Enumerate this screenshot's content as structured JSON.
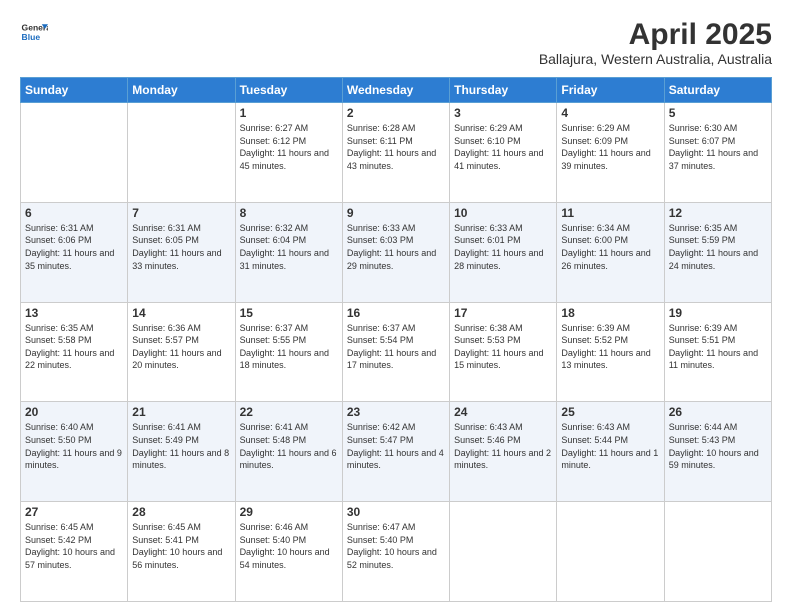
{
  "header": {
    "logo_line1": "General",
    "logo_line2": "Blue",
    "title": "April 2025",
    "subtitle": "Ballajura, Western Australia, Australia"
  },
  "weekdays": [
    "Sunday",
    "Monday",
    "Tuesday",
    "Wednesday",
    "Thursday",
    "Friday",
    "Saturday"
  ],
  "weeks": [
    [
      null,
      null,
      {
        "day": 1,
        "sunrise": "6:27 AM",
        "sunset": "6:12 PM",
        "daylight": "11 hours and 45 minutes."
      },
      {
        "day": 2,
        "sunrise": "6:28 AM",
        "sunset": "6:11 PM",
        "daylight": "11 hours and 43 minutes."
      },
      {
        "day": 3,
        "sunrise": "6:29 AM",
        "sunset": "6:10 PM",
        "daylight": "11 hours and 41 minutes."
      },
      {
        "day": 4,
        "sunrise": "6:29 AM",
        "sunset": "6:09 PM",
        "daylight": "11 hours and 39 minutes."
      },
      {
        "day": 5,
        "sunrise": "6:30 AM",
        "sunset": "6:07 PM",
        "daylight": "11 hours and 37 minutes."
      }
    ],
    [
      {
        "day": 6,
        "sunrise": "6:31 AM",
        "sunset": "6:06 PM",
        "daylight": "11 hours and 35 minutes."
      },
      {
        "day": 7,
        "sunrise": "6:31 AM",
        "sunset": "6:05 PM",
        "daylight": "11 hours and 33 minutes."
      },
      {
        "day": 8,
        "sunrise": "6:32 AM",
        "sunset": "6:04 PM",
        "daylight": "11 hours and 31 minutes."
      },
      {
        "day": 9,
        "sunrise": "6:33 AM",
        "sunset": "6:03 PM",
        "daylight": "11 hours and 29 minutes."
      },
      {
        "day": 10,
        "sunrise": "6:33 AM",
        "sunset": "6:01 PM",
        "daylight": "11 hours and 28 minutes."
      },
      {
        "day": 11,
        "sunrise": "6:34 AM",
        "sunset": "6:00 PM",
        "daylight": "11 hours and 26 minutes."
      },
      {
        "day": 12,
        "sunrise": "6:35 AM",
        "sunset": "5:59 PM",
        "daylight": "11 hours and 24 minutes."
      }
    ],
    [
      {
        "day": 13,
        "sunrise": "6:35 AM",
        "sunset": "5:58 PM",
        "daylight": "11 hours and 22 minutes."
      },
      {
        "day": 14,
        "sunrise": "6:36 AM",
        "sunset": "5:57 PM",
        "daylight": "11 hours and 20 minutes."
      },
      {
        "day": 15,
        "sunrise": "6:37 AM",
        "sunset": "5:55 PM",
        "daylight": "11 hours and 18 minutes."
      },
      {
        "day": 16,
        "sunrise": "6:37 AM",
        "sunset": "5:54 PM",
        "daylight": "11 hours and 17 minutes."
      },
      {
        "day": 17,
        "sunrise": "6:38 AM",
        "sunset": "5:53 PM",
        "daylight": "11 hours and 15 minutes."
      },
      {
        "day": 18,
        "sunrise": "6:39 AM",
        "sunset": "5:52 PM",
        "daylight": "11 hours and 13 minutes."
      },
      {
        "day": 19,
        "sunrise": "6:39 AM",
        "sunset": "5:51 PM",
        "daylight": "11 hours and 11 minutes."
      }
    ],
    [
      {
        "day": 20,
        "sunrise": "6:40 AM",
        "sunset": "5:50 PM",
        "daylight": "11 hours and 9 minutes."
      },
      {
        "day": 21,
        "sunrise": "6:41 AM",
        "sunset": "5:49 PM",
        "daylight": "11 hours and 8 minutes."
      },
      {
        "day": 22,
        "sunrise": "6:41 AM",
        "sunset": "5:48 PM",
        "daylight": "11 hours and 6 minutes."
      },
      {
        "day": 23,
        "sunrise": "6:42 AM",
        "sunset": "5:47 PM",
        "daylight": "11 hours and 4 minutes."
      },
      {
        "day": 24,
        "sunrise": "6:43 AM",
        "sunset": "5:46 PM",
        "daylight": "11 hours and 2 minutes."
      },
      {
        "day": 25,
        "sunrise": "6:43 AM",
        "sunset": "5:44 PM",
        "daylight": "11 hours and 1 minute."
      },
      {
        "day": 26,
        "sunrise": "6:44 AM",
        "sunset": "5:43 PM",
        "daylight": "10 hours and 59 minutes."
      }
    ],
    [
      {
        "day": 27,
        "sunrise": "6:45 AM",
        "sunset": "5:42 PM",
        "daylight": "10 hours and 57 minutes."
      },
      {
        "day": 28,
        "sunrise": "6:45 AM",
        "sunset": "5:41 PM",
        "daylight": "10 hours and 56 minutes."
      },
      {
        "day": 29,
        "sunrise": "6:46 AM",
        "sunset": "5:40 PM",
        "daylight": "10 hours and 54 minutes."
      },
      {
        "day": 30,
        "sunrise": "6:47 AM",
        "sunset": "5:40 PM",
        "daylight": "10 hours and 52 minutes."
      },
      null,
      null,
      null
    ]
  ],
  "labels": {
    "sunrise_prefix": "Sunrise: ",
    "sunset_prefix": "Sunset: ",
    "daylight_prefix": "Daylight: "
  }
}
